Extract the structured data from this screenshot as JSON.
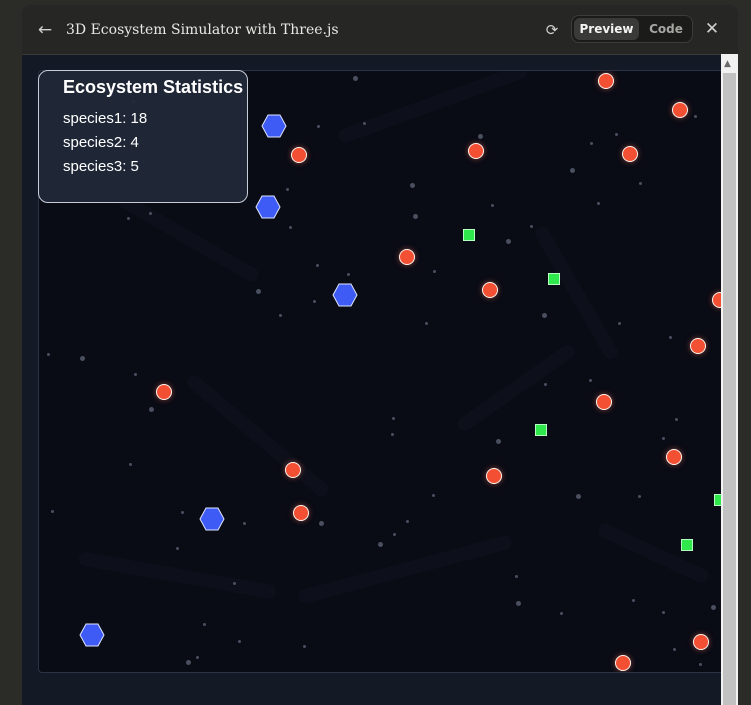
{
  "window": {
    "title": "3D Ecosystem Simulator with Three.js",
    "tabs": [
      {
        "label": "Preview",
        "active": true
      },
      {
        "label": "Code",
        "active": false
      }
    ],
    "icons": {
      "back": "arrow-left-icon",
      "refresh": "refresh-icon",
      "close": "close-icon"
    }
  },
  "stats": {
    "title": "Ecosystem Statistics",
    "rows": [
      {
        "label": "species1: 18"
      },
      {
        "label": "species2: 4"
      },
      {
        "label": "species3: 5"
      }
    ]
  },
  "colors": {
    "species1": "#f24f33",
    "species2": "#3e5bf5",
    "species3": "#2fe84b",
    "background": "#090b15"
  }
}
